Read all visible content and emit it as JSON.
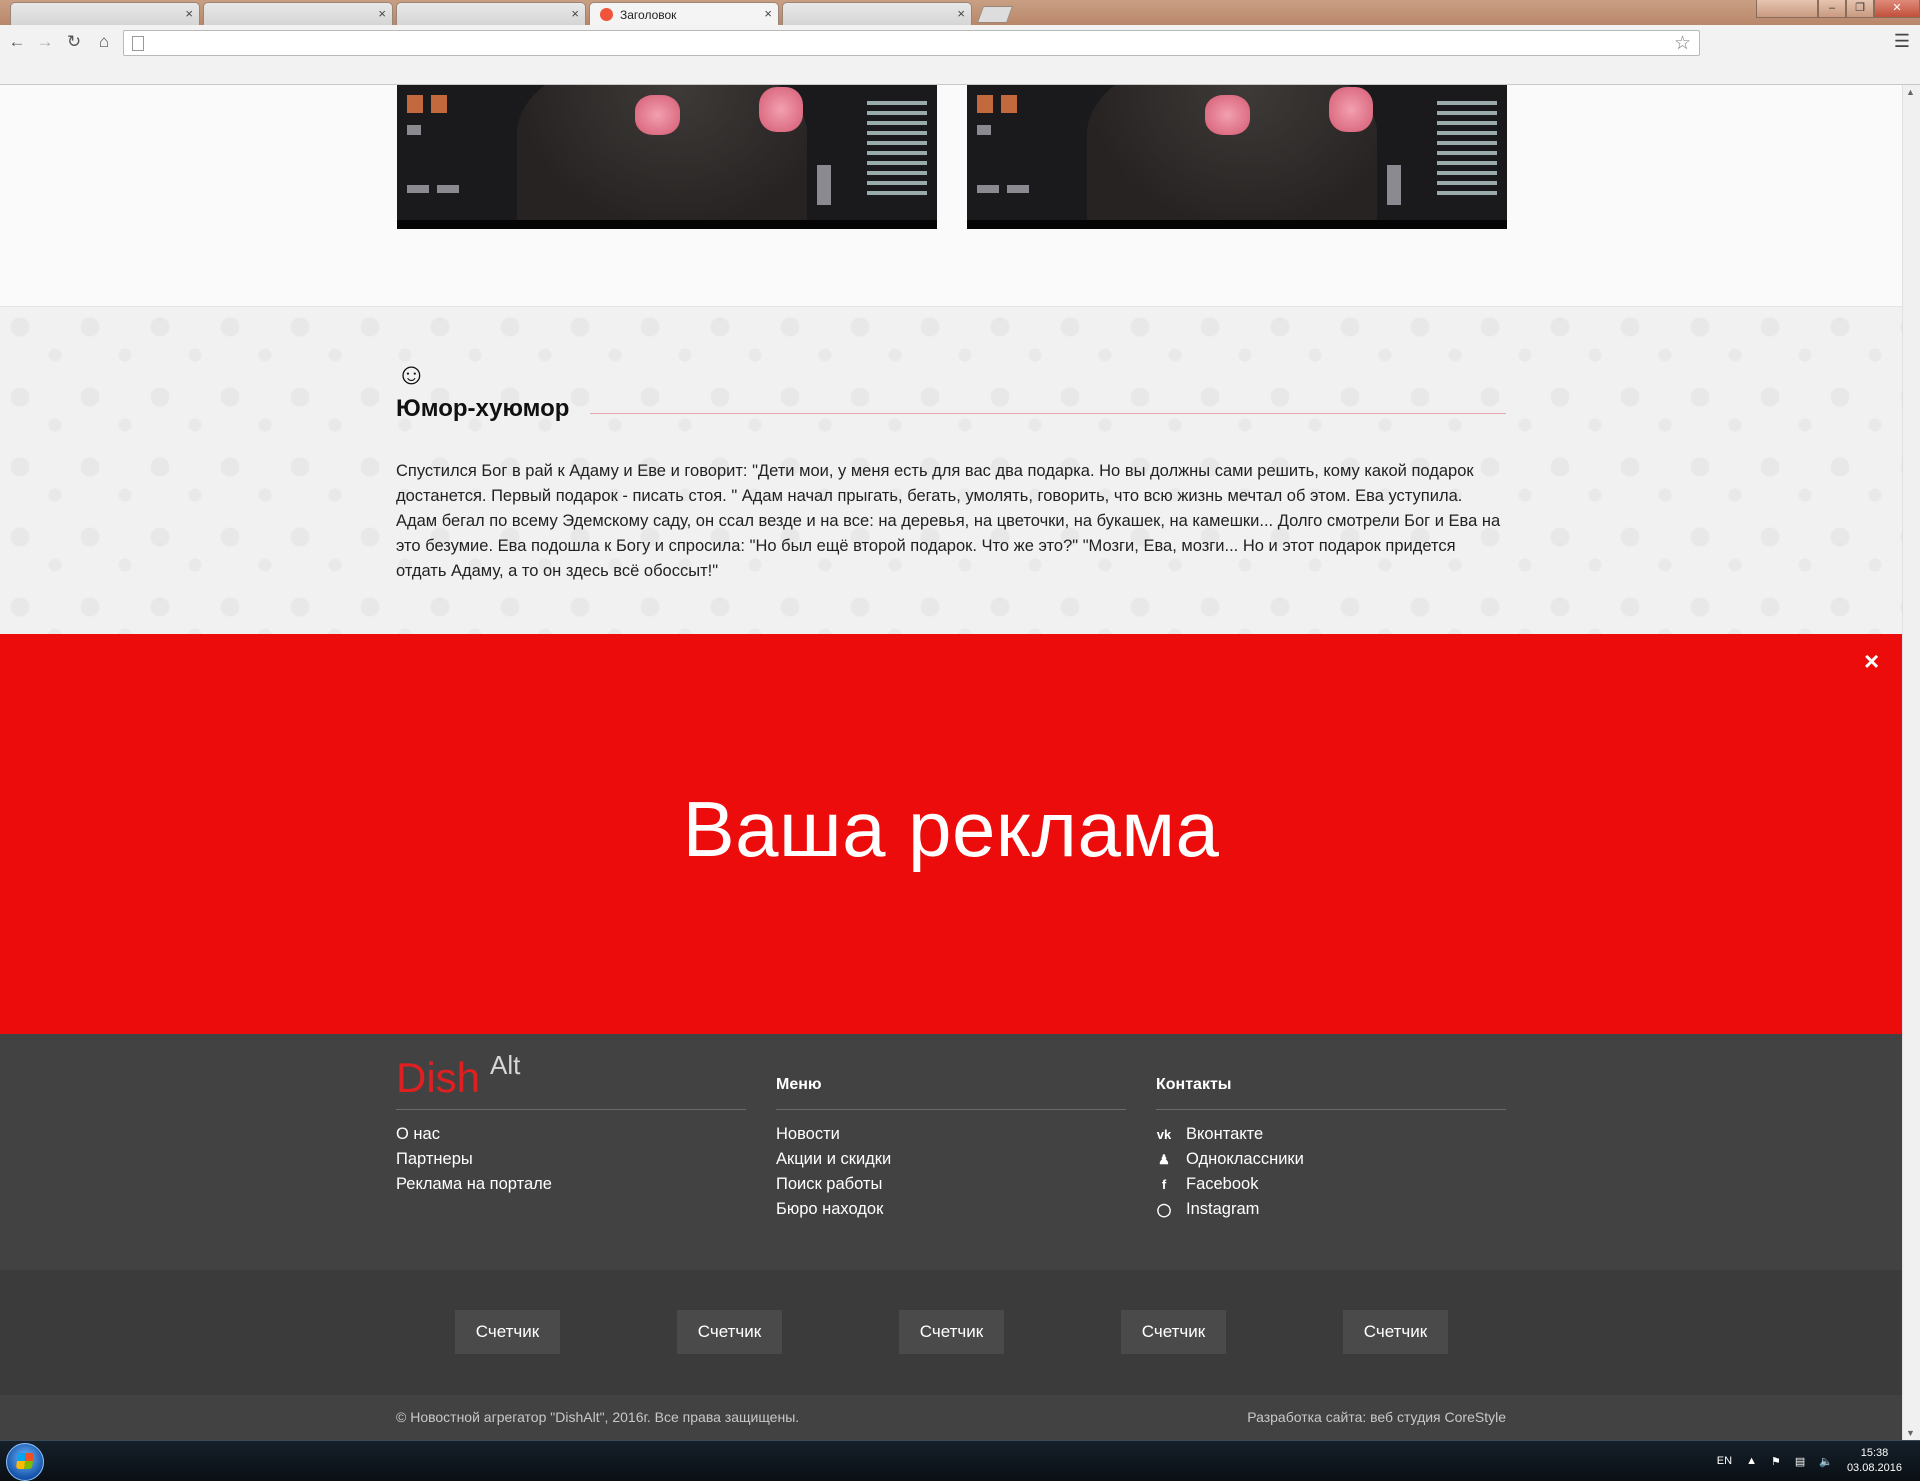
{
  "browser": {
    "tabs": [
      {
        "title": ""
      },
      {
        "title": ""
      },
      {
        "title": ""
      },
      {
        "title": "Заголовок",
        "active": true
      },
      {
        "title": ""
      }
    ],
    "tab_close": "×",
    "url": "",
    "window_controls": [
      "–",
      "❐",
      "✕"
    ]
  },
  "humor": {
    "icon": "smile-icon",
    "title": "Юмор-хуюмор",
    "text": "Спустился Бог в рай к Адаму и Еве и говорит: \"Дети мои, у меня есть для вас два подарка. Но вы должны сами решить, кому какой подарок достанется. Первый подарок - писать стоя. \" Адам начал прыгать, бегать, умолять, говорить, что всю жизнь мечтал об этом. Ева уступила. Адам бегал по всему Эдемскому саду, он ссал везде и на все: на деревья, на цветочки, на букашек, на камешки... Долго смотрели Бог и Ева на это безумие. Ева подошла к Богу и спросила: \"Но был ещё второй подарок. Что же это?\" \"Мозги, Ева, мозги... Но и этот подарок придется отдать Адаму, а то он здесь всё обоссыт!\""
  },
  "ad": {
    "text": "Ваша реклама",
    "close": "×",
    "color": "#ed0c0c"
  },
  "footer": {
    "logo": {
      "dish": "Dish",
      "alt": "Alt"
    },
    "about_links": [
      "О нас",
      "Партнеры",
      "Реклама на портале"
    ],
    "menu": {
      "title": "Меню",
      "links": [
        "Новости",
        "Акции и скидки",
        "Поиск работы",
        "Бюро находок"
      ]
    },
    "contacts": {
      "title": "Контакты",
      "links": [
        {
          "label": "Вконтакте",
          "icon": "vk-icon"
        },
        {
          "label": "Одноклассники",
          "icon": "odnoklassniki-icon"
        },
        {
          "label": "Facebook",
          "icon": "facebook-icon"
        },
        {
          "label": "Instagram",
          "icon": "instagram-icon"
        }
      ]
    },
    "counters": [
      "Счетчик",
      "Счетчик",
      "Счетчик",
      "Счетчик",
      "Счетчик"
    ],
    "copyright": "© Новостной агрегатор \"DishAlt\", 2016г. Все права защищены.",
    "developer": "Разработка сайта: веб студия CoreStyle"
  },
  "taskbar": {
    "lang": "EN",
    "time": "15:38",
    "date": "03.08.2016"
  }
}
